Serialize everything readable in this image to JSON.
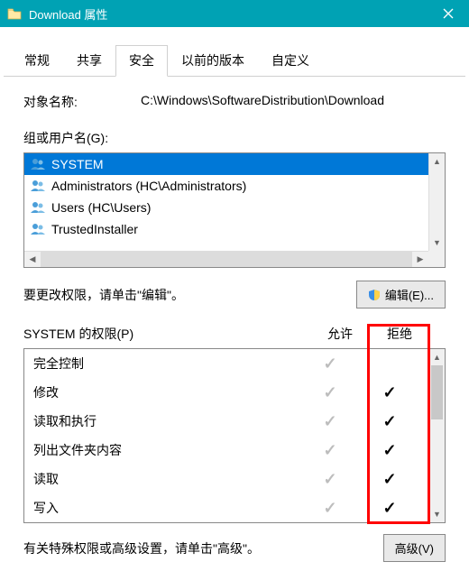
{
  "titlebar": {
    "title": "Download 属性"
  },
  "tabs": {
    "items": [
      "常规",
      "共享",
      "安全",
      "以前的版本",
      "自定义"
    ],
    "active_index": 2
  },
  "object": {
    "label": "对象名称:",
    "value": "C:\\Windows\\SoftwareDistribution\\Download"
  },
  "groups": {
    "label": "组或用户名(G):",
    "items": [
      {
        "name": "SYSTEM",
        "selected": true
      },
      {
        "name": "Administrators (HC\\Administrators)",
        "selected": false
      },
      {
        "name": "Users (HC\\Users)",
        "selected": false
      },
      {
        "name": "TrustedInstaller",
        "selected": false
      }
    ]
  },
  "edit_hint": "要更改权限，请单击\"编辑\"。",
  "edit_button": "编辑(E)...",
  "perm": {
    "label": "SYSTEM 的权限(P)",
    "col_allow": "允许",
    "col_deny": "拒绝",
    "rows": [
      {
        "name": "完全控制",
        "allow": true,
        "deny": false
      },
      {
        "name": "修改",
        "allow": true,
        "deny": true
      },
      {
        "name": "读取和执行",
        "allow": true,
        "deny": true
      },
      {
        "name": "列出文件夹内容",
        "allow": true,
        "deny": true
      },
      {
        "name": "读取",
        "allow": true,
        "deny": true
      },
      {
        "name": "写入",
        "allow": true,
        "deny": true
      }
    ]
  },
  "advanced_hint": "有关特殊权限或高级设置，请单击\"高级\"。",
  "advanced_button": "高级(V)"
}
